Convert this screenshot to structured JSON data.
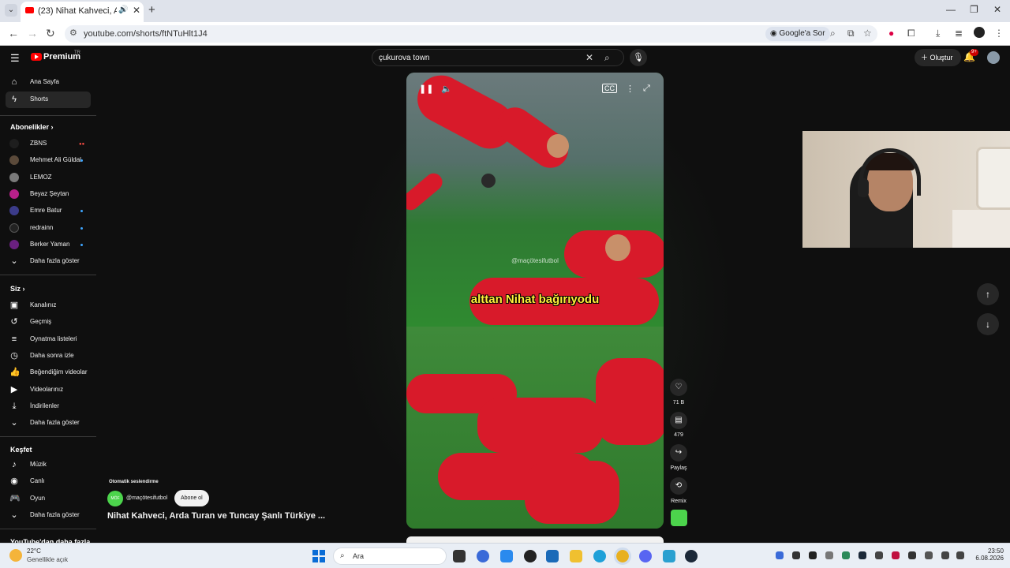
{
  "browser": {
    "tab_title": "(23) Nihat Kahveci, Arda Tu",
    "url": "youtube.com/shorts/ftNTuHlt1J4",
    "google_sor": "Google'a Sor"
  },
  "youtube": {
    "brand": "Premium",
    "country": "TR",
    "search_value": "çukurova town",
    "create_label": "Oluştur",
    "notif_count": "9+"
  },
  "sidebar": {
    "top": [
      {
        "label": "Ana Sayfa",
        "icon": "home-icon"
      },
      {
        "label": "Shorts",
        "icon": "shorts-icon"
      }
    ],
    "subs_title": "Abonelikler",
    "subs": [
      {
        "label": "ZBNS",
        "color": "#1e1e1e",
        "live": true
      },
      {
        "label": "Mehmet Ali Güldal",
        "color": "#5b4a3a",
        "dot": true
      },
      {
        "label": "LEMOZ",
        "color": "#7a7a7a"
      },
      {
        "label": "Beyaz Şeytan",
        "color": "#b8208a"
      },
      {
        "label": "Emre Batur",
        "color": "#3b3b8a",
        "dot": true
      },
      {
        "label": "redrainn",
        "color": "#222222",
        "dot": true
      },
      {
        "label": "Berker Yaman",
        "color": "#6a2080",
        "dot": true
      }
    ],
    "subs_more": "Daha fazla göster",
    "you_title": "Siz",
    "you": [
      {
        "label": "Kanalınız",
        "icon": "channel-icon"
      },
      {
        "label": "Geçmiş",
        "icon": "history-icon"
      },
      {
        "label": "Oynatma listeleri",
        "icon": "playlist-icon"
      },
      {
        "label": "Daha sonra izle",
        "icon": "clock-icon"
      },
      {
        "label": "Beğendiğim videolar",
        "icon": "like-icon"
      },
      {
        "label": "Videolarınız",
        "icon": "video-icon"
      },
      {
        "label": "İndirilenler",
        "icon": "download-icon"
      }
    ],
    "you_more": "Daha fazla göster",
    "explore_title": "Keşfet",
    "explore": [
      {
        "label": "Müzik",
        "icon": "music-icon"
      },
      {
        "label": "Canlı",
        "icon": "live-icon"
      },
      {
        "label": "Oyun",
        "icon": "gaming-icon"
      }
    ],
    "explore_more": "Daha fazla göster",
    "more_from_yt": "YouTube'dan daha fazla"
  },
  "short": {
    "caption": "alttan Nihat bağırıyodu",
    "watermark": "@maçötesifutbol",
    "auto_dubbed": "Otomatik seslendirme",
    "channel_handle": "@maçötesifutbol",
    "channel_avatar_text": "MÖF",
    "subscribe_label": "Abone ol",
    "title": "Nihat Kahveci, Arda Turan ve Tuncay Şanlı Türkiye ...",
    "likes": "71 B",
    "comments": "479",
    "share_label": "Paylaş",
    "remix_label": "Remix"
  },
  "taskbar": {
    "temp": "22°C",
    "weather": "Genellikle açık",
    "search_placeholder": "Ara",
    "time": "23:50",
    "date": "6.08.2026"
  }
}
